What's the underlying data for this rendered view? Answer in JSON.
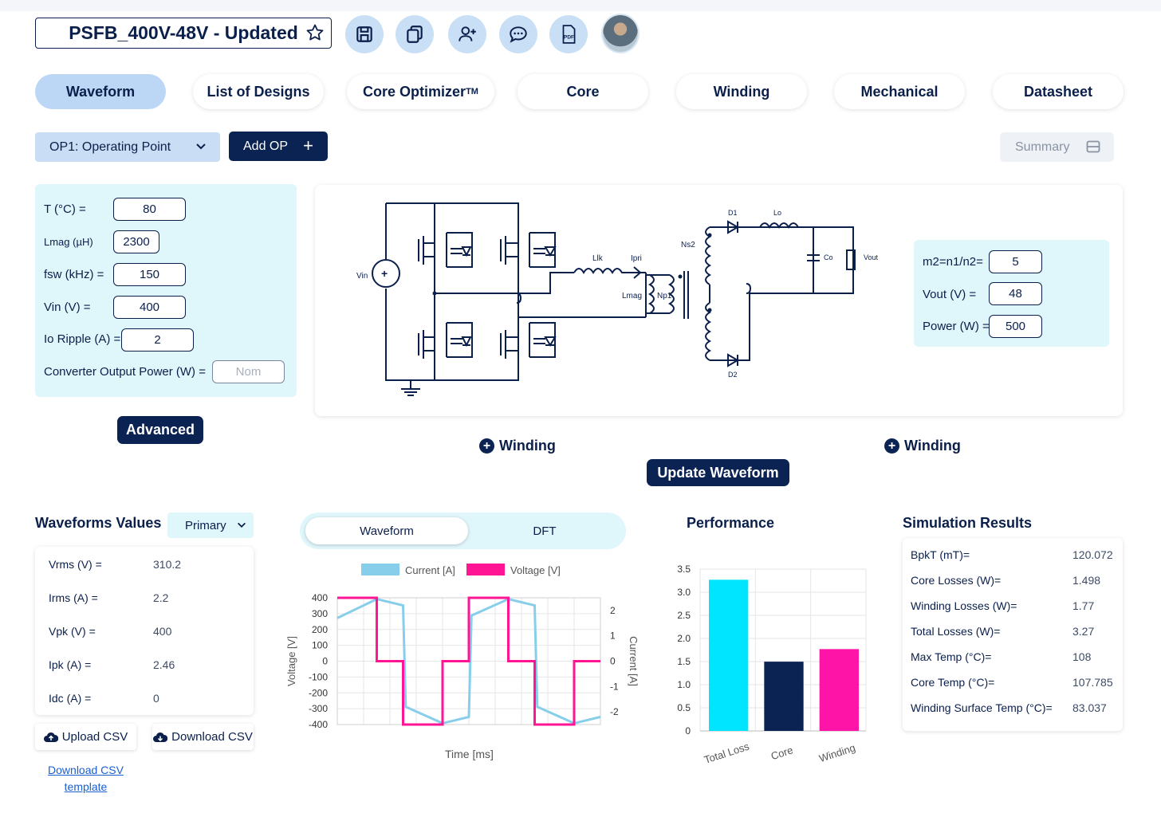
{
  "header": {
    "design_name": "PSFB_400V-48V - Updated",
    "icons": [
      "star-icon",
      "save-icon",
      "copy-icon",
      "add-user-icon",
      "chat-icon",
      "pdf-icon"
    ]
  },
  "tabs": [
    {
      "label": "Waveform",
      "active": true
    },
    {
      "label": "List of Designs"
    },
    {
      "label": "Core Optimizer",
      "sup": "TM"
    },
    {
      "label": "Core"
    },
    {
      "label": "Winding"
    },
    {
      "label": "Mechanical"
    },
    {
      "label": "Datasheet"
    }
  ],
  "toolbar": {
    "op_select": "OP1: Operating Point",
    "add_op": "Add OP",
    "summary": "Summary"
  },
  "params": {
    "temp_label": "T (°C) =",
    "temp": "80",
    "lmag_label": "Lmag (µH)",
    "lmag": "2300",
    "fsw_label": "fsw (kHz) =",
    "fsw": "150",
    "vin_label": "Vin (V) =",
    "vin": "400",
    "ripple_label": "Io Ripple (A) =",
    "ripple": "2",
    "power_label": "Converter Output Power (W) =",
    "power_placeholder": "Nom",
    "advanced": "Advanced"
  },
  "schematic": {
    "labels": {
      "vin": "Vin",
      "llk": "Llk",
      "ipri": "Ipri",
      "lmag": "Lmag",
      "np1": "Np1",
      "ns2": "Ns2",
      "d1": "D1",
      "d2": "D2",
      "lo": "Lo",
      "co": "Co",
      "vout": "Vout"
    }
  },
  "secondary": {
    "ratio_label": "m2=n1/n2=",
    "ratio": "5",
    "vout_label": "Vout (V) =",
    "vout": "48",
    "power_label": "Power (W) =",
    "power": "500"
  },
  "add_winding_1": "Winding",
  "add_winding_2": "Winding",
  "update_waveform": "Update Waveform",
  "waveform_values": {
    "title": "Waveforms Values",
    "selector": "Primary",
    "rows": [
      {
        "label": "Vrms (V) =",
        "value": "310.2"
      },
      {
        "label": "Irms (A) =",
        "value": "2.2"
      },
      {
        "label": "Vpk (V) =",
        "value": "400"
      },
      {
        "label": "Ipk (A) =",
        "value": "2.46"
      },
      {
        "label": "Idc (A) =",
        "value": "0"
      }
    ],
    "upload": "Upload CSV",
    "download": "Download CSV",
    "template_link_1": "Download CSV",
    "template_link_2": "template"
  },
  "wave_tabs": {
    "active": "Waveform",
    "other": "DFT"
  },
  "chart_data": [
    {
      "type": "line",
      "title": "",
      "xlabel": "Time [ms]",
      "ylabel": "Voltage [V]",
      "y2label": "Current [A]",
      "ylim": [
        -400,
        400
      ],
      "y2lim": [
        -2.5,
        2.5
      ],
      "y_ticks": [
        "400",
        "300",
        "200",
        "100",
        "0",
        "-100",
        "-200",
        "-300",
        "-400"
      ],
      "y2_ticks": [
        "2",
        "1",
        "0",
        "-1",
        "-2"
      ],
      "series": [
        {
          "name": "Current [A]",
          "axis": "y2",
          "color": "#87ceeb",
          "points": [
            [
              0,
              1.7
            ],
            [
              0.15,
              2.45
            ],
            [
              0.25,
              2.2
            ],
            [
              0.26,
              -1.8
            ],
            [
              0.4,
              -2.45
            ],
            [
              0.5,
              -2.2
            ],
            [
              0.51,
              1.8
            ],
            [
              0.65,
              2.45
            ],
            [
              0.75,
              2.2
            ],
            [
              0.76,
              -1.8
            ],
            [
              0.9,
              -2.45
            ],
            [
              1,
              -2.2
            ]
          ]
        },
        {
          "name": "Voltage [V]",
          "axis": "y",
          "color": "#ff1493",
          "points": [
            [
              0,
              400
            ],
            [
              0.15,
              400
            ],
            [
              0.15,
              0
            ],
            [
              0.25,
              0
            ],
            [
              0.25,
              -400
            ],
            [
              0.4,
              -400
            ],
            [
              0.4,
              0
            ],
            [
              0.5,
              0
            ],
            [
              0.5,
              400
            ],
            [
              0.65,
              400
            ],
            [
              0.65,
              0
            ],
            [
              0.75,
              0
            ],
            [
              0.75,
              -400
            ],
            [
              0.9,
              -400
            ],
            [
              0.9,
              0
            ],
            [
              1,
              0
            ]
          ]
        }
      ]
    },
    {
      "type": "bar",
      "title": "Performance",
      "categories": [
        "Total Loss",
        "Core",
        "Winding"
      ],
      "values": [
        3.27,
        1.498,
        1.77
      ],
      "colors": [
        "#00e5ff",
        "#0a2353",
        "#ff14a8"
      ],
      "ylim": [
        0,
        3.5
      ],
      "y_ticks": [
        "3.5",
        "3.0",
        "2.5",
        "2.0",
        "1.5",
        "1.0",
        "0.5",
        "0"
      ]
    }
  ],
  "simulation": {
    "title": "Simulation Results",
    "rows": [
      {
        "label": "BpkT (mT)=",
        "value": "120.072"
      },
      {
        "label": "Core Losses (W)=",
        "value": "1.498"
      },
      {
        "label": "Winding Losses (W)=",
        "value": "1.77"
      },
      {
        "label": "Total Losses (W)=",
        "value": "3.27"
      },
      {
        "label": "Max Temp (°C)=",
        "value": "108"
      },
      {
        "label": "Core Temp (°C)=",
        "value": "107.785"
      },
      {
        "label": "Winding Surface Temp (°C)=",
        "value": "83.037"
      }
    ]
  }
}
